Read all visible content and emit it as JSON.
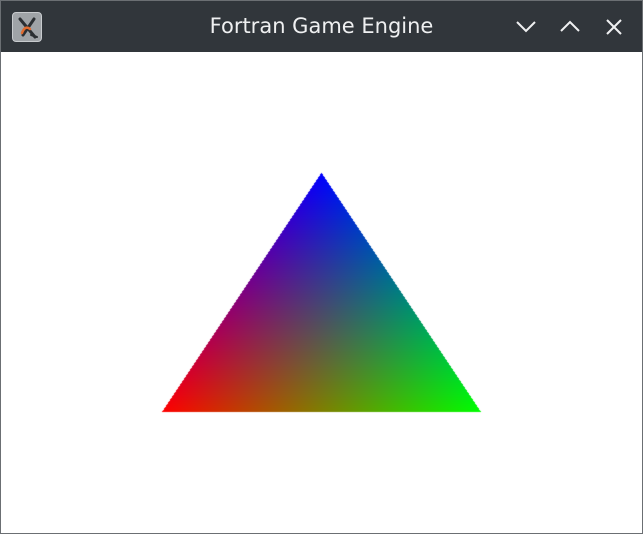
{
  "window": {
    "title": "Fortran Game Engine",
    "app_icon": "app-icon",
    "controls": [
      {
        "name": "minimize",
        "icon": "chevron-down-icon"
      },
      {
        "name": "maximize",
        "icon": "chevron-up-icon"
      },
      {
        "name": "close",
        "icon": "close-icon"
      }
    ]
  },
  "colors": {
    "titlebar_bg": "#31363b",
    "titlebar_text": "#eff0f1",
    "content_bg": "#ffffff",
    "vertex_left": "#ff0000",
    "vertex_right": "#00ff00",
    "vertex_top": "#0000ff"
  },
  "scene": {
    "shape": "triangle",
    "shading": "per-vertex color interpolation"
  }
}
